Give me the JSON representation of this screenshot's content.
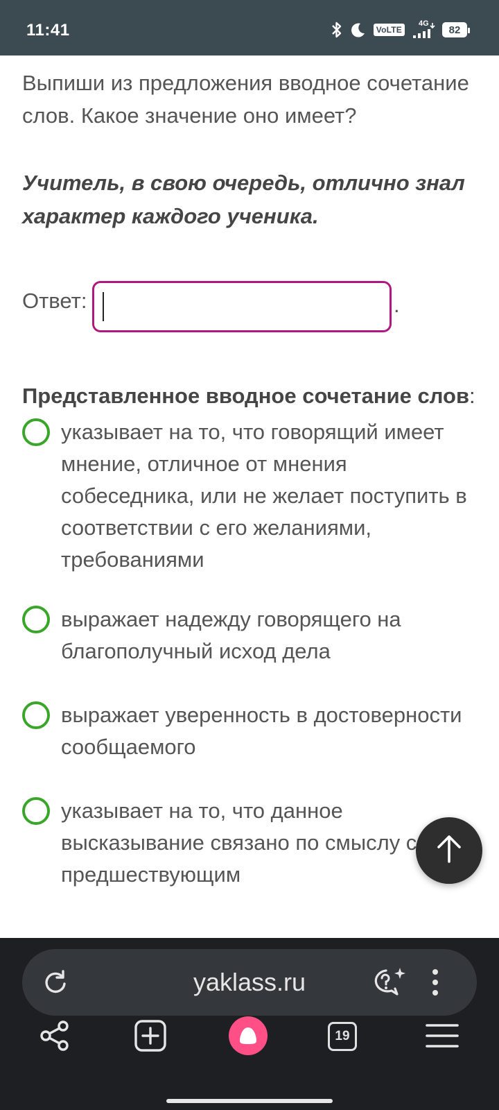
{
  "status_bar": {
    "time": "11:41",
    "volte": "VoLTE",
    "network": "4G",
    "battery": "82"
  },
  "question": {
    "prompt": "Выпиши из предложения вводное сочетание слов. Какое значение оно имеет?",
    "sentence": "Учитель, в свою очередь, отлично знал характер каждого ученика."
  },
  "answer": {
    "label": "Ответ:",
    "value": "",
    "suffix": "."
  },
  "options": {
    "title": "Представленное вводное сочетание слов",
    "title_suffix": ":",
    "items": [
      {
        "label": "указывает на то, что говорящий имеет мнение, отличное от мнения собеседника, или не желает поступить в соответствии с его желаниями, требованиями"
      },
      {
        "label": "выражает надежду говорящего на благополучный исход дела"
      },
      {
        "label": "выражает уверенность в достоверности сообщаемого"
      },
      {
        "label": "указывает на то, что данное высказывание связано по смыслу с предшествующим"
      }
    ]
  },
  "browser": {
    "url": "yaklass.ru",
    "tab_count": "19"
  },
  "colors": {
    "status_bar": "#3c4a52",
    "input_border": "#b0187f",
    "radio_border": "#3aa629",
    "browser_bg": "#1d1f22",
    "alice": "#ff4f87"
  }
}
